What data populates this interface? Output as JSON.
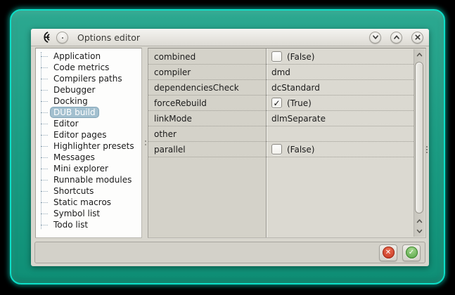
{
  "window": {
    "title": "Options editor",
    "icons": {
      "logo": "coedit-logo-icon",
      "menu": "window-menu-icon",
      "shade": "chevron-down-icon",
      "maximize": "chevron-up-icon",
      "close": "close-icon"
    }
  },
  "sidebar": {
    "items": [
      "Application",
      "Code metrics",
      "Compilers paths",
      "Debugger",
      "Docking",
      "DUB build",
      "Editor",
      "Editor pages",
      "Highlighter presets",
      "Messages",
      "Mini explorer",
      "Runnable modules",
      "Shortcuts",
      "Static macros",
      "Symbol list",
      "Todo list"
    ],
    "selected": "DUB build"
  },
  "properties": {
    "check_glyph": "✓",
    "rows": [
      {
        "name": "combined",
        "kind": "bool",
        "checked": false,
        "value": "(False)"
      },
      {
        "name": "compiler",
        "kind": "text",
        "value": "dmd"
      },
      {
        "name": "dependenciesCheck",
        "kind": "text",
        "value": "dcStandard"
      },
      {
        "name": "forceRebuild",
        "kind": "bool",
        "checked": true,
        "value": "(True)"
      },
      {
        "name": "linkMode",
        "kind": "text",
        "value": "dlmSeparate"
      },
      {
        "name": "other",
        "kind": "text",
        "value": ""
      },
      {
        "name": "parallel",
        "kind": "bool",
        "checked": false,
        "value": "(False)"
      }
    ]
  },
  "footer": {
    "buttons": [
      {
        "name": "cancel",
        "icon": "cancel-cross-icon",
        "glyph": "✕",
        "color": "#c23420"
      },
      {
        "name": "ok",
        "icon": "ok-check-icon",
        "glyph": "✓",
        "color": "#4f9f3f"
      }
    ]
  },
  "colors": {
    "frame_teal_top": "#2ca890",
    "frame_teal_bottom": "#0f8f76",
    "frame_edge": "#0be0c8",
    "selection_bg": "#a3c0cf",
    "dialog_bg": "#d8d6ce",
    "grid_name_col": "#d4d2c9",
    "grid_value_col": "#dbd9d1"
  }
}
